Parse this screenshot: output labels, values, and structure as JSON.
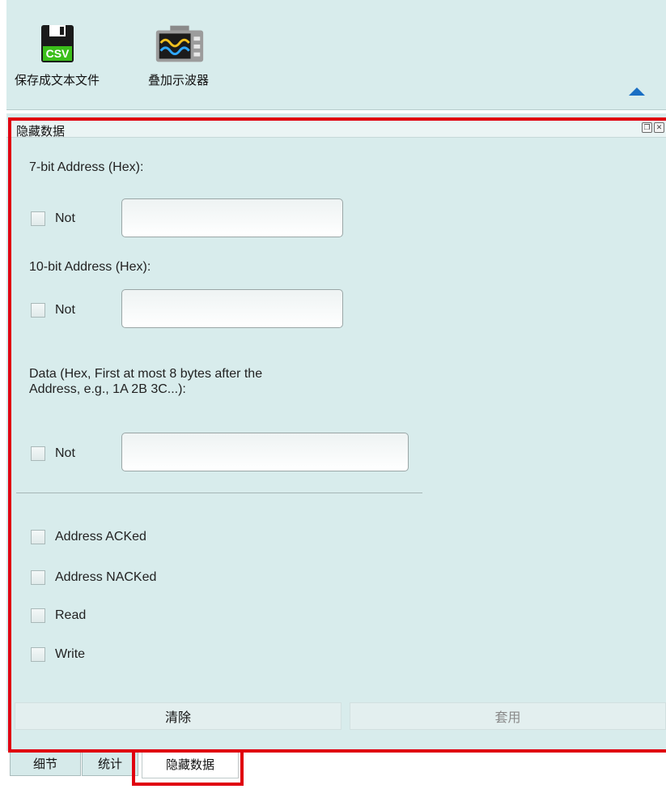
{
  "toolbar": {
    "save_csv_label": "保存成文本文件",
    "csv_icon_text": "CSV",
    "overlay_scope_label": "叠加示波器"
  },
  "panel": {
    "title": "隐藏数据",
    "addr7_label": "7-bit Address (Hex):",
    "addr7_not": "Not",
    "addr7_value": "",
    "addr10_label": "10-bit Address (Hex):",
    "addr10_not": "Not",
    "addr10_value": "",
    "data_label_line1": "Data (Hex, First at most 8 bytes after the",
    "data_label_line2": "Address, e.g., 1A 2B 3C...):",
    "data_not": "Not",
    "data_value": "",
    "checkboxes": [
      "Address ACKed",
      "Address NACKed",
      "Read",
      "Write"
    ],
    "clear_label": "清除",
    "apply_label": "套用"
  },
  "tabs": [
    "细节",
    "统计",
    "隐藏数据"
  ],
  "colors": {
    "panel_bg": "#d8ecec",
    "highlight": "#e0000f",
    "accent_arrow": "#1a6fc4"
  }
}
